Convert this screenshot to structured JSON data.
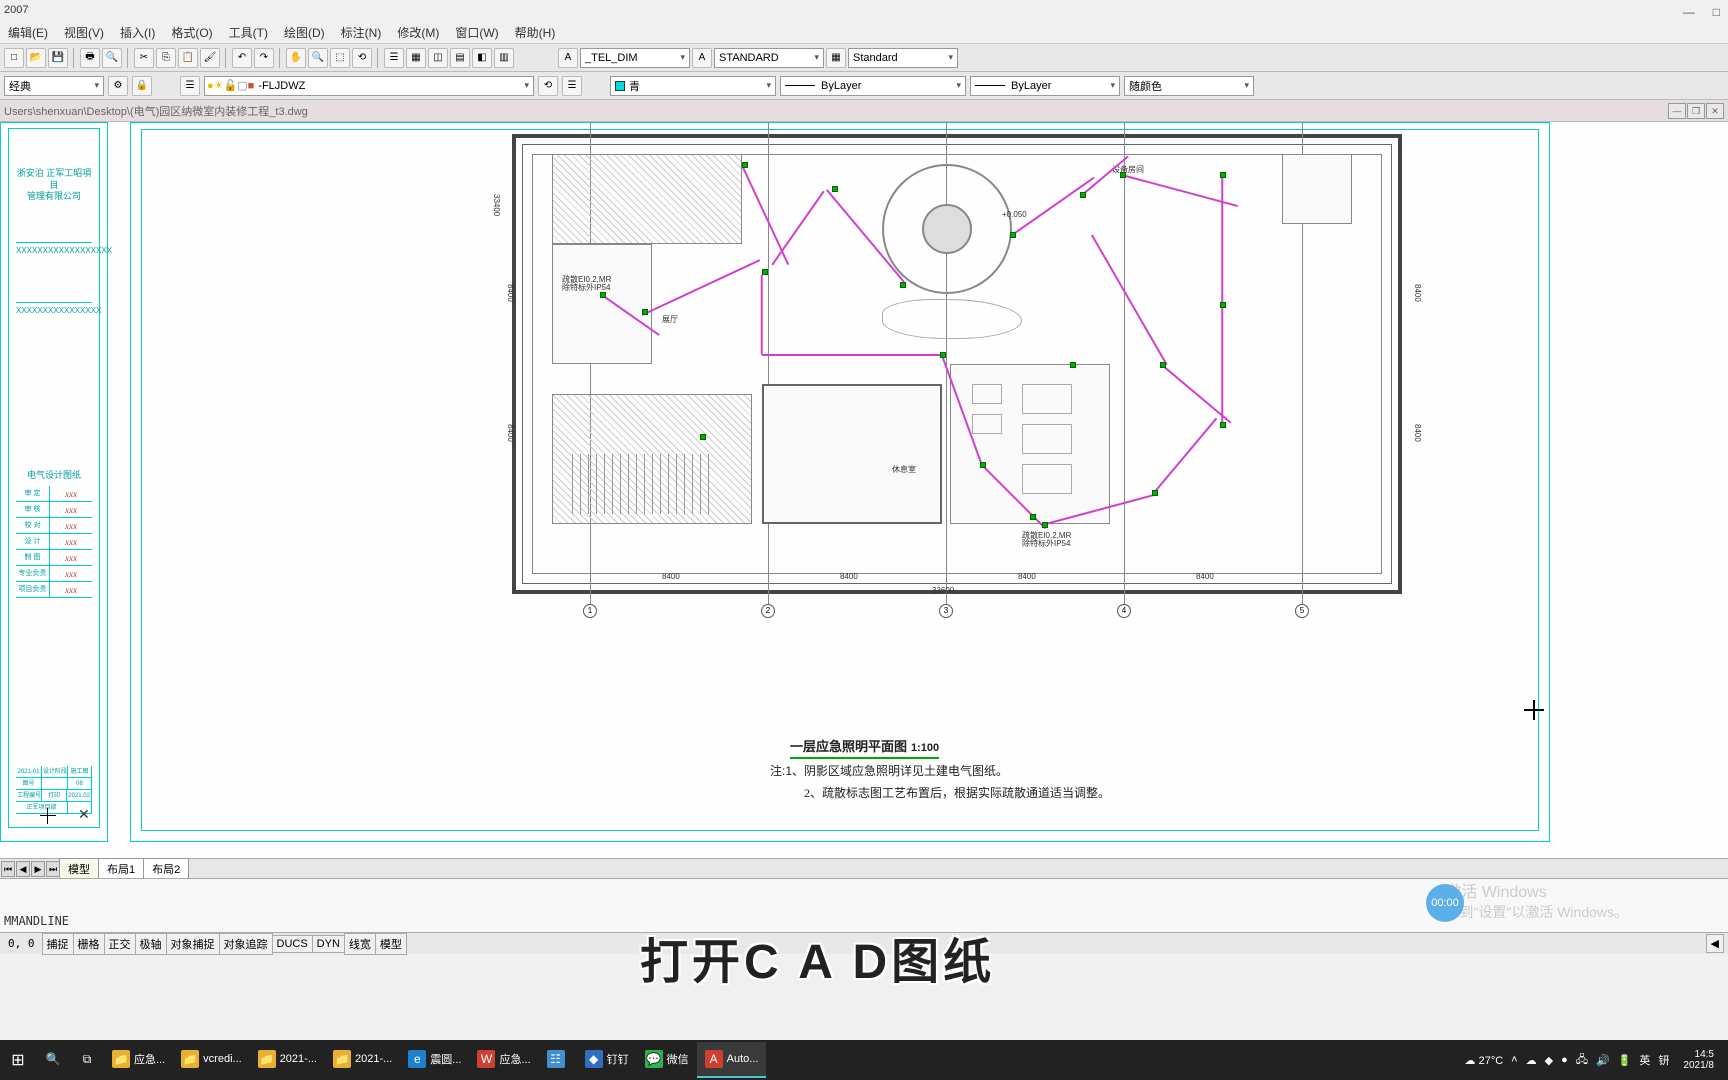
{
  "window": {
    "title": "2007",
    "minimize": "—",
    "maximize": "□"
  },
  "menu": {
    "edit": "编辑(E)",
    "view": "视图(V)",
    "insert": "插入(I)",
    "format": "格式(O)",
    "tools": "工具(T)",
    "draw": "绘图(D)",
    "dim": "标注(N)",
    "modify": "修改(M)",
    "window": "窗口(W)",
    "help": "帮助(H)"
  },
  "styles": {
    "dim": "_TEL_DIM",
    "text": "STANDARD",
    "table": "Standard"
  },
  "props": {
    "leftcombo": "经典",
    "layer": "-FLJDWZ",
    "color": "青",
    "ltype": "ByLayer",
    "lweight": "ByLayer",
    "plotstyle": "随颜色"
  },
  "doc": {
    "path": "Users\\shenxuan\\Desktop\\(电气)园区纳微室内装修工程_t3.dwg"
  },
  "titleblock": {
    "proj1": "浙安泊 正军工昭項目",
    "proj2": "管理有限公司",
    "stamp1": "XXXXXXXXXXXXXXXXXX",
    "stamp2": "XXXXXXXXXXXXXXXX",
    "sect": "电气设计图纸",
    "rows": [
      {
        "r": "审 定",
        "s": "xxx"
      },
      {
        "r": "审 核",
        "s": "xxx"
      },
      {
        "r": "校 对",
        "s": "xxx"
      },
      {
        "r": "设 计",
        "s": "xxx"
      },
      {
        "r": "制 图",
        "s": "xxx"
      },
      {
        "r": "专业负责",
        "s": "xxx"
      },
      {
        "r": "项目负责",
        "s": "xxx"
      }
    ],
    "bot": [
      [
        "2021-01",
        "设计阶段",
        "施工图"
      ],
      [
        "图号",
        "",
        "08"
      ],
      [
        "工程编号",
        "打印",
        "2021.02"
      ],
      [
        "正军项目部",
        "",
        ""
      ]
    ]
  },
  "plan": {
    "title": "一层应急照明平面图",
    "scale": "1:100",
    "note_pre": "注:",
    "note1": "1、阴影区域应急照明详见土建电气图纸。",
    "note2": "2、疏散标志图工艺布置后，根据实际疏散通道适当调整。",
    "dim_total": "33600",
    "dims": [
      "8400",
      "8400",
      "8400",
      "8400",
      "8400"
    ],
    "equiproom": "设备房间",
    "labelA": "疏散EI0.2,MR",
    "labelA2": "除特标外IP54",
    "labelB": "疏散EI0.2,MR",
    "labelB2": "除特标外IP54",
    "dim_v1": "33400",
    "dim_v2": "8400",
    "dim_v3": "8400",
    "dim_v4": "8400"
  },
  "tabs": {
    "model": "模型",
    "l1": "布局1",
    "l2": "布局2"
  },
  "cmd": {
    "prompt": "MMANDLINE"
  },
  "status": {
    "coords": "0, 0",
    "btns": [
      "捕捉",
      "栅格",
      "正交",
      "极轴",
      "对象捕捉",
      "对象追踪",
      "DUCS",
      "DYN",
      "线宽",
      "模型"
    ]
  },
  "watermark": {
    "l1": "激活 Windows",
    "l2": "转到\"设置\"以激活 Windows。"
  },
  "timer": "00:00",
  "subtitle": "打开C A D图纸",
  "taskbar": {
    "items": [
      {
        "icon": "📁",
        "color": "#e8b030",
        "label": "应急..."
      },
      {
        "icon": "📁",
        "color": "#e8b030",
        "label": "vcredi..."
      },
      {
        "icon": "📁",
        "color": "#e8b030",
        "label": "2021-..."
      },
      {
        "icon": "📁",
        "color": "#e8b030",
        "label": "2021-..."
      },
      {
        "icon": "e",
        "color": "#2080d0",
        "label": "震圆..."
      },
      {
        "icon": "W",
        "color": "#d04030",
        "label": "应急..."
      },
      {
        "icon": "☷",
        "color": "#4090d0",
        "label": ""
      },
      {
        "icon": "◆",
        "color": "#3070c0",
        "label": "钉钉"
      },
      {
        "icon": "💬",
        "color": "#30b050",
        "label": "微信"
      },
      {
        "icon": "A",
        "color": "#d04030",
        "label": "Auto..."
      }
    ],
    "weather": "27°C",
    "ime1": "英",
    "ime2": "钘",
    "time": "14:5",
    "date": "2021/8"
  }
}
